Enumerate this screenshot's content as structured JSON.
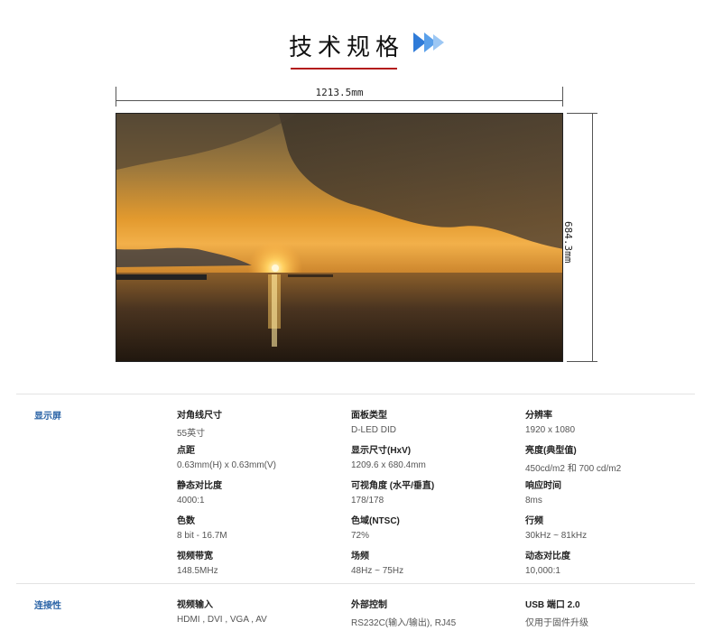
{
  "header": {
    "title": "技术规格",
    "accent_color": "#b31b1b",
    "arrow_color": "#2f7bd8",
    "arrow_icon": "double-chevron-right-icon"
  },
  "dimensions": {
    "width_label": "1213.5mm",
    "height_label": "684.3mm"
  },
  "photo": {
    "description_icon": "sunset-sea-image"
  },
  "specs": {
    "display_label": "显示屏",
    "connectivity_label": "连接性",
    "display": [
      {
        "k": "对角线尺寸",
        "v": "55英寸"
      },
      {
        "k": "面板类型",
        "v": "D-LED DID"
      },
      {
        "k": "分辨率",
        "v": "1920 x 1080"
      },
      {
        "k": "点距",
        "v": "0.63mm(H) x 0.63mm(V)"
      },
      {
        "k": "显示尺寸(HxV)",
        "v": "1209.6 x 680.4mm"
      },
      {
        "k": "亮度(典型值)",
        "v": "450cd/m2 和 700 cd/m2"
      },
      {
        "k": "静态对比度",
        "v": "4000:1"
      },
      {
        "k": "可视角度 (水平/垂直)",
        "v": "178/178"
      },
      {
        "k": "响应时间",
        "v": "8ms"
      },
      {
        "k": "色数",
        "v": "8 bit - 16.7M"
      },
      {
        "k": "色域(NTSC)",
        "v": "72%"
      },
      {
        "k": "行频",
        "v": "30kHz ~ 81kHz"
      },
      {
        "k": "视频带宽",
        "v": "148.5MHz"
      },
      {
        "k": "场频",
        "v": "48Hz ~ 75Hz"
      },
      {
        "k": "动态对比度",
        "v": "10,000:1"
      }
    ],
    "connectivity": [
      {
        "k": "视频输入",
        "v": "HDMI , DVI , VGA , AV"
      },
      {
        "k": "外部控制",
        "v": "RS232C(输入/输出), RJ45"
      },
      {
        "k": "USB 端口 2.0",
        "v": "仅用于固件升级"
      }
    ],
    "label_color": "#2a63a6"
  }
}
